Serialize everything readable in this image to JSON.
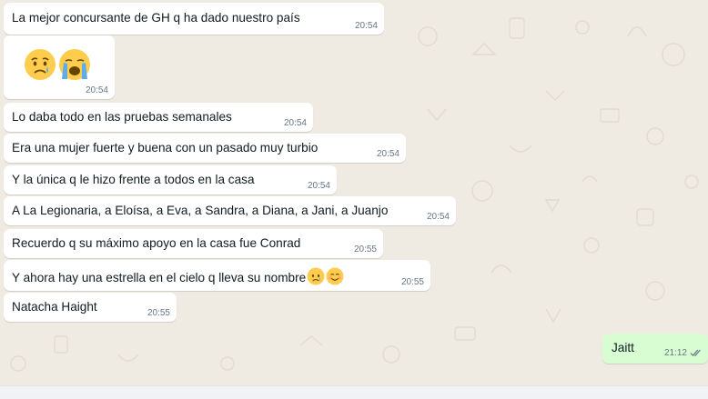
{
  "colors": {
    "chat_bg": "#efeae2",
    "incoming_bubble": "#ffffff",
    "outgoing_bubble": "#d9fdd3",
    "timestamp": "#667781",
    "read_ticks": "#667781"
  },
  "messages": [
    {
      "text": "La mejor concursante de GH q ha dado nuestro país",
      "time": "20:54"
    },
    {
      "emoji": [
        "sad-but-relieved-face",
        "loudly-crying-face"
      ],
      "time": "20:54"
    },
    {
      "text": "Lo daba todo en las pruebas semanales",
      "time": "20:54"
    },
    {
      "text": "Era una mujer fuerte y buena con un pasado muy turbio",
      "time": "20:54"
    },
    {
      "text": "Y la única q le hizo frente a todos en la casa",
      "time": "20:54"
    },
    {
      "text": "A La Legionaria, a Eloísa, a Eva, a Sandra, a Diana, a Jani, a Juanjo",
      "time": "20:54"
    },
    {
      "text": "Recuerdo q su máximo apoyo en la casa fue Conrad",
      "time": "20:55"
    },
    {
      "text": "Y ahora hay una estrella en el cielo q lleva su nombre",
      "emoji_after": [
        "sad-but-relieved-face",
        "smiling-face"
      ],
      "time": "20:55"
    },
    {
      "text": "Natacha Haight",
      "time": "20:55"
    }
  ],
  "outgoing": {
    "text": "Jaitt",
    "time": "21:12",
    "status_icon": "double-check-icon"
  }
}
